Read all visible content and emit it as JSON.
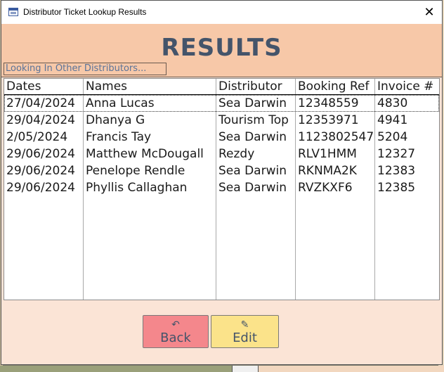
{
  "window": {
    "title": "Distributor Ticket Lookup Results",
    "close_glyph": "✕"
  },
  "header": {
    "heading": "RESULTS",
    "other_distributors_label": "Looking In Other Distributors..."
  },
  "table": {
    "columns": [
      "Dates",
      "Names",
      "Distributor",
      "Booking Ref",
      "Invoice #"
    ],
    "rows": [
      [
        "27/04/2024",
        "Anna Lucas",
        "Sea Darwin",
        "12348559",
        "4830"
      ],
      [
        "29/04/2024",
        "Dhanya G",
        "Tourism Top",
        "12353971",
        "4941"
      ],
      [
        "2/05/2024",
        "Francis Tay",
        "Sea Darwin",
        "1123802547",
        "5204"
      ],
      [
        "29/06/2024",
        "Matthew McDougall",
        "Rezdy",
        "RLV1HMM",
        "12327"
      ],
      [
        "29/06/2024",
        "Penelope Rendle",
        "Sea Darwin",
        "RKNMA2K",
        "12383"
      ],
      [
        "29/06/2024",
        "Phyllis Callaghan",
        "Sea Darwin",
        "RVZKXF6",
        "12385"
      ]
    ]
  },
  "buttons": {
    "back_label": "Back",
    "back_icon": "undo-arrow-icon",
    "back_glyph": "↶",
    "edit_label": "Edit",
    "edit_icon": "pencil-icon",
    "edit_glyph": "✎"
  },
  "colors": {
    "header_bg": "#f7c8a8",
    "body_bg": "#fbe4d6",
    "heading_text": "#44546a",
    "back_button": "#f4878c",
    "edit_button": "#fbe38a"
  }
}
